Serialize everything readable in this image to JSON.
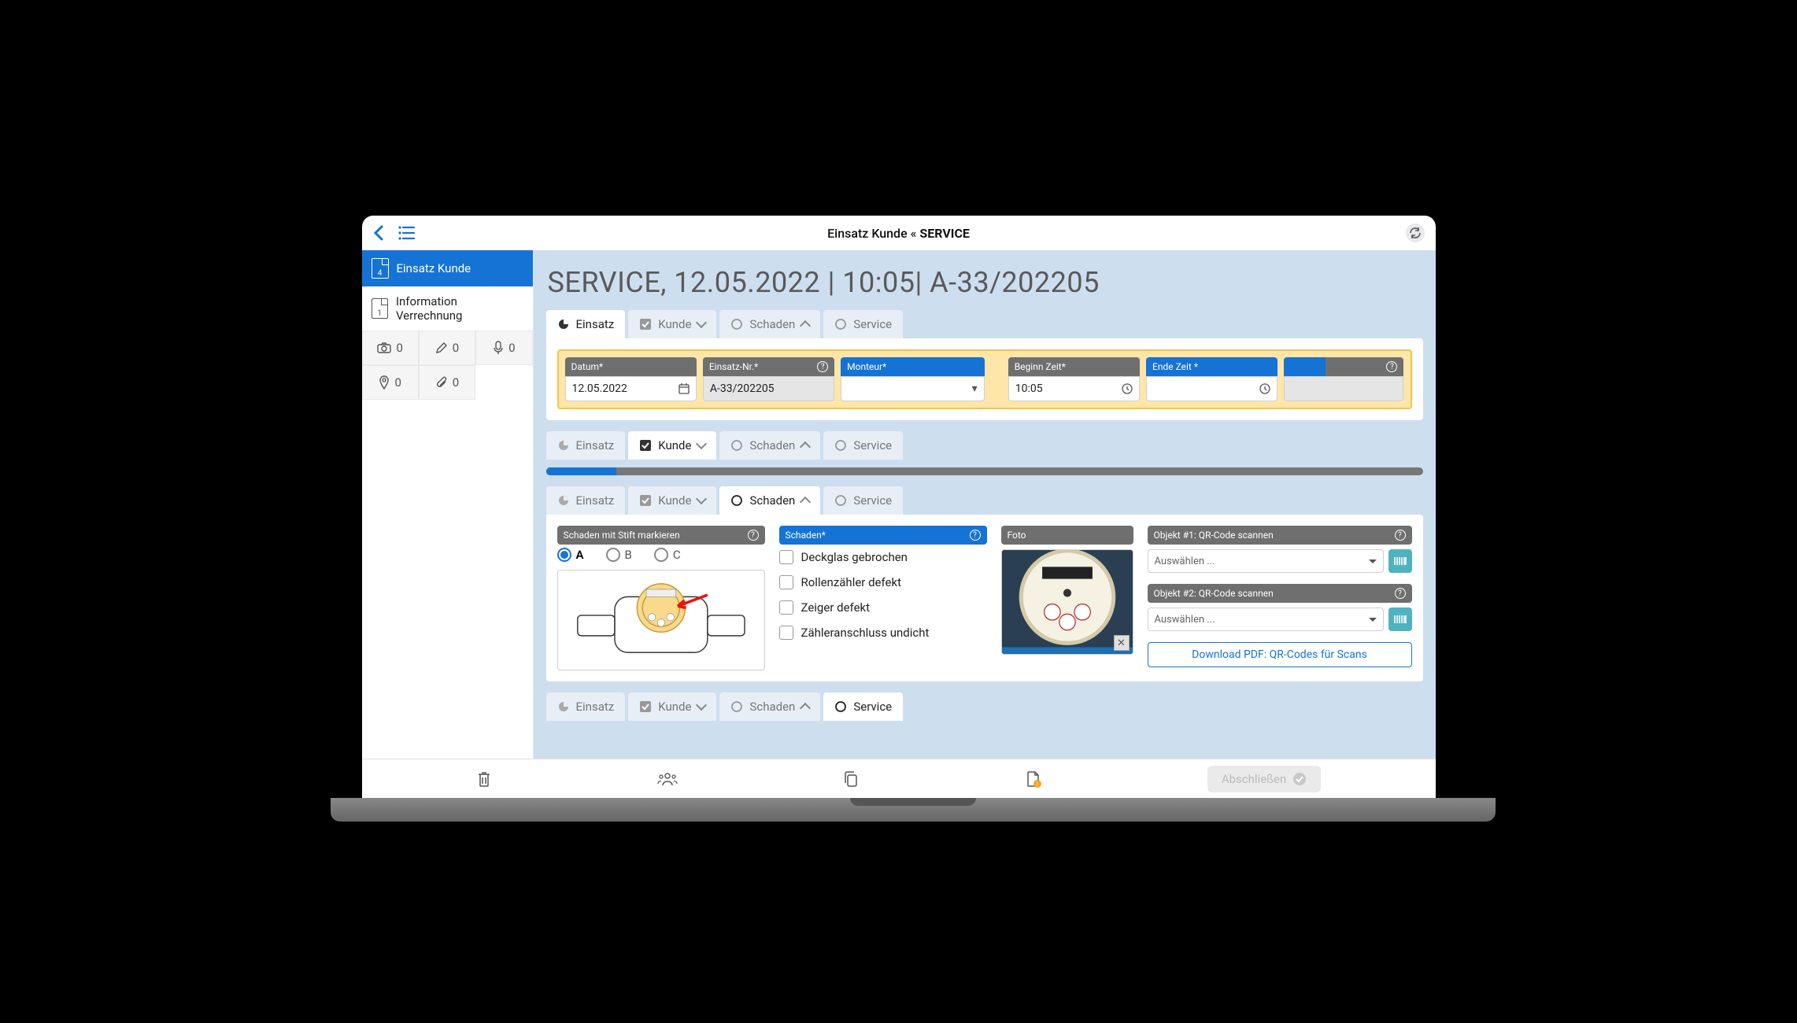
{
  "topbar": {
    "title_prefix": "Einsatz Kunde « ",
    "title_main": "SERVICE"
  },
  "sidebar": {
    "items": [
      {
        "label": "Einsatz Kunde",
        "badge": "4"
      },
      {
        "label": "Information Verrechnung",
        "badge": "1"
      }
    ],
    "tools": {
      "camera": "0",
      "pencil": "0",
      "mic": "0",
      "pin": "0",
      "clip": "0"
    }
  },
  "page": {
    "title": "SERVICE,  12.05.2022 | 10:05| A-33/202205"
  },
  "tabs": {
    "t0": "Einsatz",
    "t1": "Kunde",
    "t2": "Schaden",
    "t3": "Service"
  },
  "einsatz": {
    "datum_label": "Datum*",
    "datum_value": "12.05.2022",
    "nr_label": "Einsatz-Nr.*",
    "nr_value": "A-33/202205",
    "monteur_label": "Monteur*",
    "beginn_label": "Beginn Zeit*",
    "beginn_value": "10:05",
    "ende_label": "Ende Zeit *"
  },
  "schaden": {
    "mark_label": "Schaden mit Stift markieren",
    "opt_a": "A",
    "opt_b": "B",
    "opt_c": "C",
    "list_label": "Schaden*",
    "item0": "Deckglas gebrochen",
    "item1": "Rollenzähler defekt",
    "item2": "Zeiger defekt",
    "item3": "Zähleranschluss undicht",
    "foto_label": "Foto",
    "qr1_label": "Objekt #1: QR-Code scannen",
    "qr2_label": "Objekt #2: QR-Code scannen",
    "select_ph": "Auswählen ...",
    "download": "Download PDF: QR-Codes für Scans"
  },
  "bottom": {
    "finish": "Abschließen"
  }
}
